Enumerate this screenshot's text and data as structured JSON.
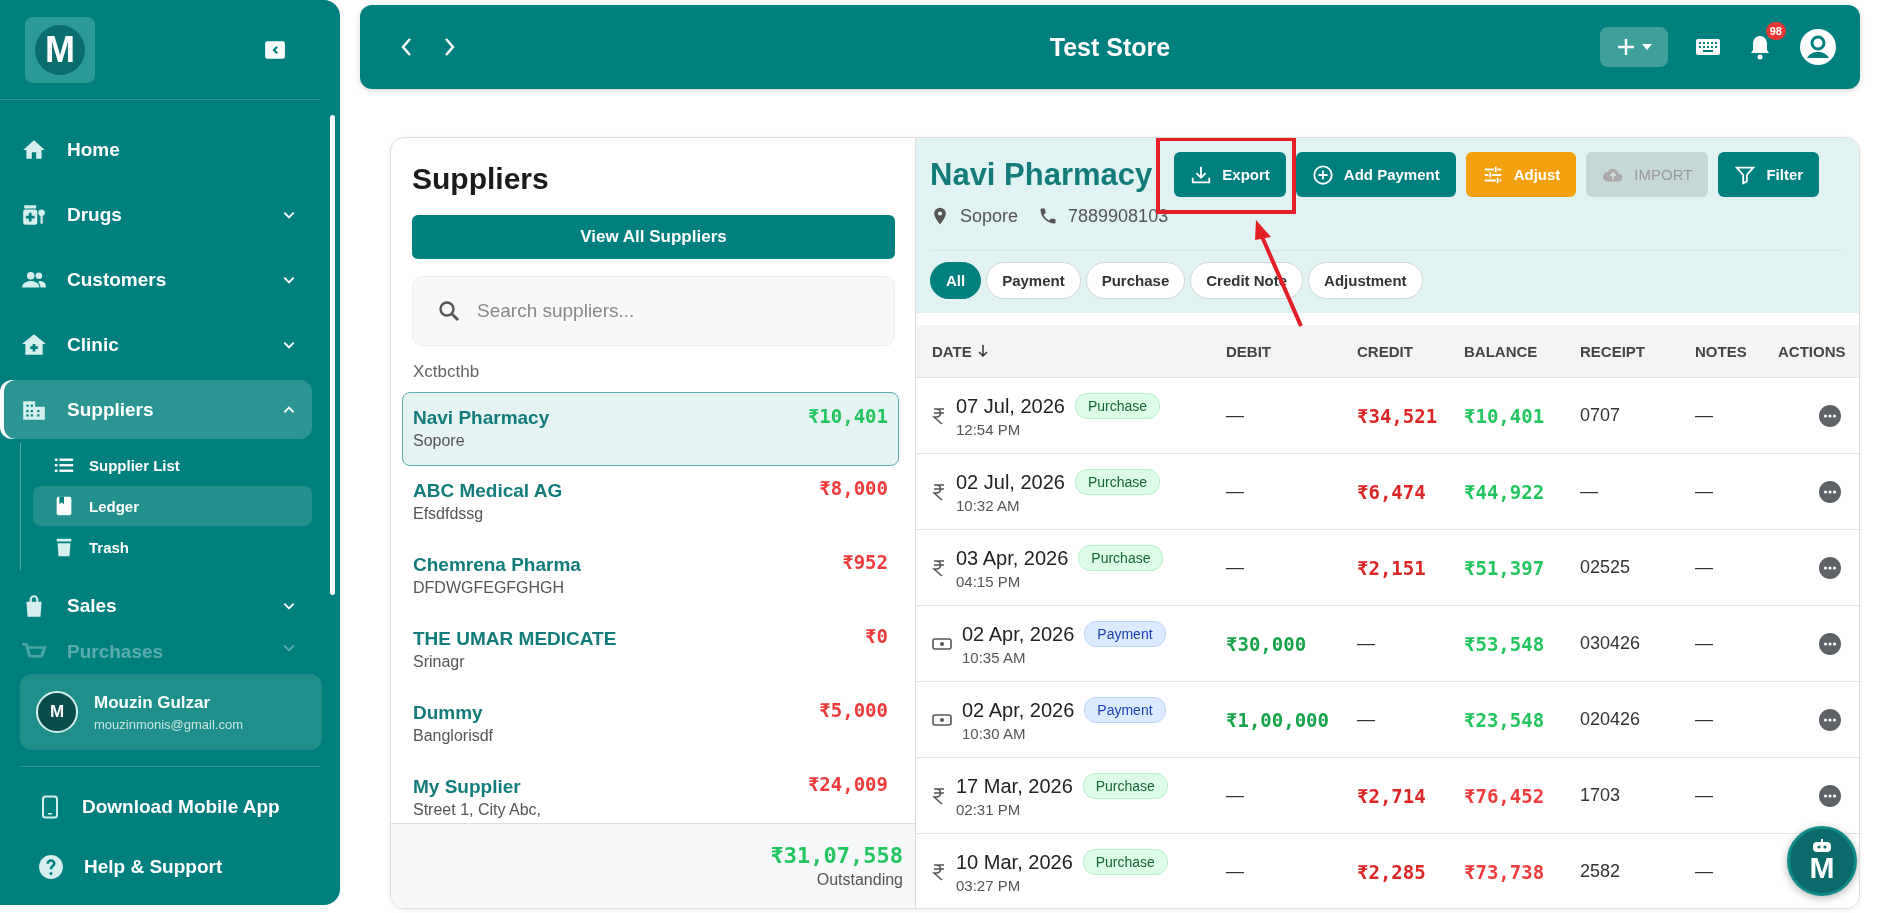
{
  "sidebar": {
    "logo_letter": "M",
    "items": [
      {
        "label": "Home",
        "expandable": false,
        "selected": false
      },
      {
        "label": "Drugs",
        "expandable": true,
        "expanded": false,
        "selected": false
      },
      {
        "label": "Customers",
        "expandable": true,
        "expanded": false,
        "selected": false
      },
      {
        "label": "Clinic",
        "expandable": true,
        "expanded": false,
        "selected": false
      },
      {
        "label": "Suppliers",
        "expandable": true,
        "expanded": true,
        "selected": true,
        "children": [
          {
            "label": "Supplier List",
            "selected": false
          },
          {
            "label": "Ledger",
            "selected": true
          },
          {
            "label": "Trash",
            "selected": false
          }
        ]
      },
      {
        "label": "Sales",
        "expandable": true,
        "expanded": false,
        "selected": false
      },
      {
        "label": "Purchases",
        "expandable": true,
        "expanded": false,
        "selected": false
      }
    ],
    "user": {
      "initial": "M",
      "name": "Mouzin Gulzar",
      "email": "mouzinmonis@gmail.com"
    },
    "footer_links": [
      "Download Mobile App",
      "Help & Support"
    ]
  },
  "topbar": {
    "title": "Test Store",
    "notification_count": "98"
  },
  "suppliers_panel": {
    "title": "Suppliers",
    "view_all_button": "View All Suppliers",
    "search": {
      "placeholder": "Search suppliers..."
    },
    "partial_row_text": "Xctbcthb",
    "suppliers": [
      {
        "name": "Navi Pharmacy",
        "address": "Sopore",
        "amount": "₹10,401",
        "color": "#22c55e",
        "selected": true
      },
      {
        "name": "ABC Medical AG",
        "address": "Efsdfdssg",
        "amount": "₹8,000",
        "color": "#ef3b3b",
        "selected": false
      },
      {
        "name": "Chemrena Pharma",
        "address": "DFDWGFEGFGHGH",
        "amount": "₹952",
        "color": "#ef3b3b",
        "selected": false
      },
      {
        "name": "THE UMAR MEDICATE",
        "address": "Srinagr",
        "amount": "₹0",
        "color": "#ef3b3b",
        "selected": false
      },
      {
        "name": "Dummy",
        "address": "Banglorisdf",
        "amount": "₹5,000",
        "color": "#ef3b3b",
        "selected": false
      },
      {
        "name": "My Supplier",
        "address": "Street 1, City Abc,",
        "amount": "₹24,009",
        "color": "#ef3b3b",
        "selected": false
      }
    ],
    "total": "₹31,07,558",
    "total_label": "Outstanding"
  },
  "ledger": {
    "supplier_name": "Navi Pharmacy",
    "location": "Sopore",
    "phone": "7889908103",
    "buttons": [
      {
        "label": "Export",
        "kind": "primary",
        "disabled": false,
        "highlighted": true
      },
      {
        "label": "Add Payment",
        "kind": "primary",
        "disabled": false,
        "highlighted": false
      },
      {
        "label": "Adjust",
        "kind": "warning",
        "disabled": false,
        "highlighted": false
      },
      {
        "label": "IMPORT",
        "kind": "primary",
        "disabled": true,
        "highlighted": false
      },
      {
        "label": "Filter",
        "kind": "primary",
        "disabled": false,
        "highlighted": false
      }
    ],
    "filters": [
      {
        "label": "All",
        "selected": true
      },
      {
        "label": "Payment",
        "selected": false
      },
      {
        "label": "Purchase",
        "selected": false
      },
      {
        "label": "Credit Note",
        "selected": false
      },
      {
        "label": "Adjustment",
        "selected": false
      }
    ],
    "columns": [
      {
        "label": "DATE",
        "sorted": true
      },
      {
        "label": "DEBIT",
        "sorted": false
      },
      {
        "label": "CREDIT",
        "sorted": false
      },
      {
        "label": "BALANCE",
        "sorted": false
      },
      {
        "label": "RECEIPT",
        "sorted": false
      },
      {
        "label": "NOTES",
        "sorted": false
      },
      {
        "label": "ACTIONS",
        "sorted": false
      }
    ],
    "rows": [
      {
        "kind": "purchase",
        "date": "07 Jul, 2026",
        "time": "12:54 PM",
        "type_label": "Purchase",
        "debit": "—",
        "credit": "₹34,521",
        "balance": "₹10,401",
        "color": "#22c55e",
        "receipt": "0707",
        "notes": "—"
      },
      {
        "kind": "purchase",
        "date": "02 Jul, 2026",
        "time": "10:32 AM",
        "type_label": "Purchase",
        "debit": "—",
        "credit": "₹6,474",
        "balance": "₹44,922",
        "color": "#22c55e",
        "receipt": "—",
        "notes": "—"
      },
      {
        "kind": "purchase",
        "date": "03 Apr, 2026",
        "time": "04:15 PM",
        "type_label": "Purchase",
        "debit": "—",
        "credit": "₹2,151",
        "balance": "₹51,397",
        "color": "#22c55e",
        "receipt": "02525",
        "notes": "—"
      },
      {
        "kind": "payment",
        "date": "02 Apr, 2026",
        "time": "10:35 AM",
        "type_label": "Payment",
        "debit": "₹30,000",
        "credit": "—",
        "balance": "₹53,548",
        "color": "#22c55e",
        "receipt": "030426",
        "notes": "—"
      },
      {
        "kind": "payment",
        "date": "02 Apr, 2026",
        "time": "10:30 AM",
        "type_label": "Payment",
        "debit": "₹1,00,000",
        "credit": "—",
        "balance": "₹23,548",
        "color": "#22c55e",
        "receipt": "020426",
        "notes": "—"
      },
      {
        "kind": "purchase",
        "date": "17 Mar, 2026",
        "time": "02:31 PM",
        "type_label": "Purchase",
        "debit": "—",
        "credit": "₹2,714",
        "balance": "₹76,452",
        "color": "#ef3b3b",
        "receipt": "1703",
        "notes": "—"
      },
      {
        "kind": "purchase",
        "date": "10 Mar, 2026",
        "time": "03:27 PM",
        "type_label": "Purchase",
        "debit": "—",
        "credit": "₹2,285",
        "balance": "₹73,738",
        "color": "#ef3b3b",
        "receipt": "2582",
        "notes": "—"
      }
    ]
  },
  "assistant_button": {
    "letter": "M"
  }
}
